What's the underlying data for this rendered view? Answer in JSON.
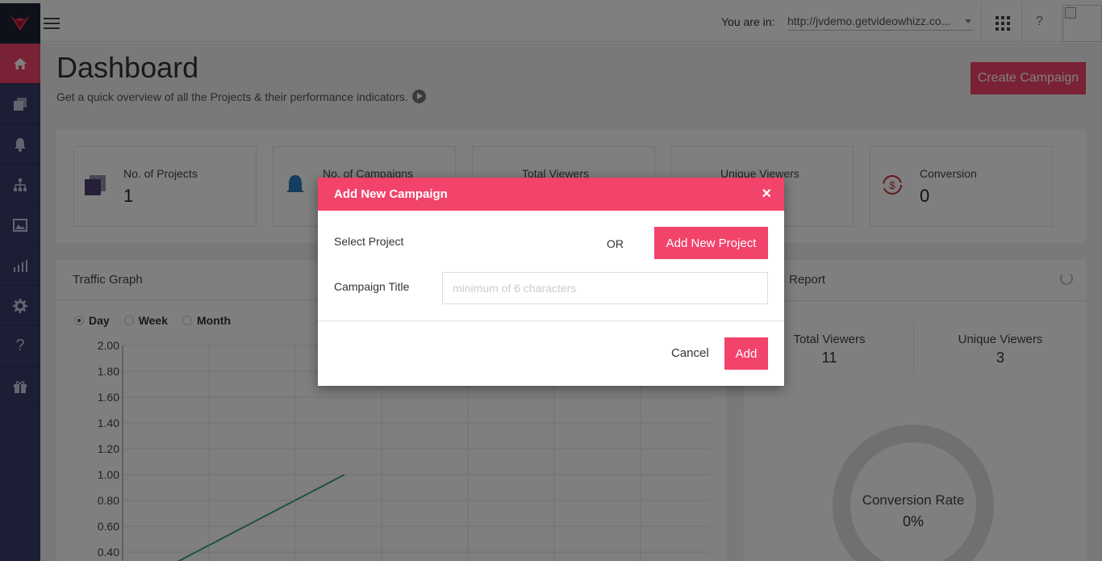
{
  "header": {
    "you_are_in_label": "You are in:",
    "url_value": "http://jvdemo.getvideowhizz.co...",
    "help_label": "?"
  },
  "sidebar": {
    "items": [
      {
        "name": "home-icon",
        "glyph": "⌂"
      },
      {
        "name": "projects-icon",
        "glyph": "▤"
      },
      {
        "name": "bell-icon",
        "glyph": "🔔"
      },
      {
        "name": "sitemap-icon",
        "glyph": "⚯"
      },
      {
        "name": "image-icon",
        "glyph": "▨"
      },
      {
        "name": "bar-chart-icon",
        "glyph": "▮"
      },
      {
        "name": "gear-icon",
        "glyph": "⚙"
      },
      {
        "name": "help-icon",
        "glyph": "?"
      },
      {
        "name": "gift-icon",
        "glyph": "🎁"
      }
    ]
  },
  "page": {
    "title": "Dashboard",
    "subtitle": "Get a quick overview of all the Projects & their performance indicators.",
    "create_campaign_label": "Create Campaign"
  },
  "stats": [
    {
      "label": "No. of Projects",
      "value": "1"
    },
    {
      "label": "No. of Campaigns",
      "value": ""
    },
    {
      "label": "Total Viewers",
      "value": ""
    },
    {
      "label": "Unique Viewers",
      "value": ""
    },
    {
      "label": "Conversion",
      "value": "0"
    }
  ],
  "traffic": {
    "title": "Traffic Graph",
    "ranges": [
      "Day",
      "Week",
      "Month"
    ],
    "selected_range": "Day"
  },
  "report": {
    "title": "Report",
    "total_viewers_label": "Total Viewers",
    "total_viewers_value": "11",
    "unique_viewers_label": "Unique Viewers",
    "unique_viewers_value": "3",
    "conversion_rate_label": "Conversion Rate",
    "conversion_rate_value": "0%"
  },
  "chart_data": {
    "type": "line",
    "y_ticks": [
      "2.00",
      "1.80",
      "1.60",
      "1.40",
      "1.20",
      "1.00",
      "0.80",
      "0.60",
      "0.40"
    ],
    "ylim": [
      0.4,
      2.0
    ],
    "points": [
      {
        "x": 0,
        "y": 0.3
      },
      {
        "x": 1,
        "y": 1.0
      }
    ],
    "colors": {
      "line": "#3fa57b"
    }
  },
  "modal": {
    "title": "Add New Campaign",
    "close_glyph": "×",
    "select_project_label": "Select Project",
    "or_label": "OR",
    "add_new_project_label": "Add New Project",
    "campaign_title_label": "Campaign Title",
    "campaign_title_placeholder": "minimum of 6 characters",
    "campaign_title_value": "",
    "cancel_label": "Cancel",
    "add_label": "Add"
  },
  "colors": {
    "accent": "#f2436b",
    "sidebar": "#363c6a"
  }
}
